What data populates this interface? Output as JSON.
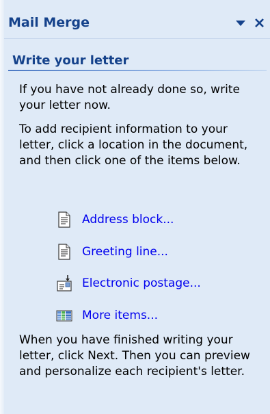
{
  "pane": {
    "title": "Mail Merge",
    "dropdown_icon": "dropdown-arrow-icon",
    "close_icon": "close-icon"
  },
  "section": {
    "title": "Write your letter"
  },
  "paragraphs": [
    "If you have not already done so, write your letter now.",
    "To add recipient information to your letter, click a location in the document, and then click one of the items below.",
    "When you have finished writing your letter, click Next. Then you can preview and personalize each recipient's letter."
  ],
  "items": [
    {
      "label": "Address block...",
      "icon": "document-icon"
    },
    {
      "label": "Greeting line...",
      "icon": "document-icon"
    },
    {
      "label": "Electronic postage...",
      "icon": "postage-icon"
    },
    {
      "label": "More items...",
      "icon": "database-fields-icon"
    }
  ],
  "colors": {
    "pane_background": "#dfeaf7",
    "heading": "#15428b",
    "link": "#0000ee",
    "body_text": "#000000"
  }
}
